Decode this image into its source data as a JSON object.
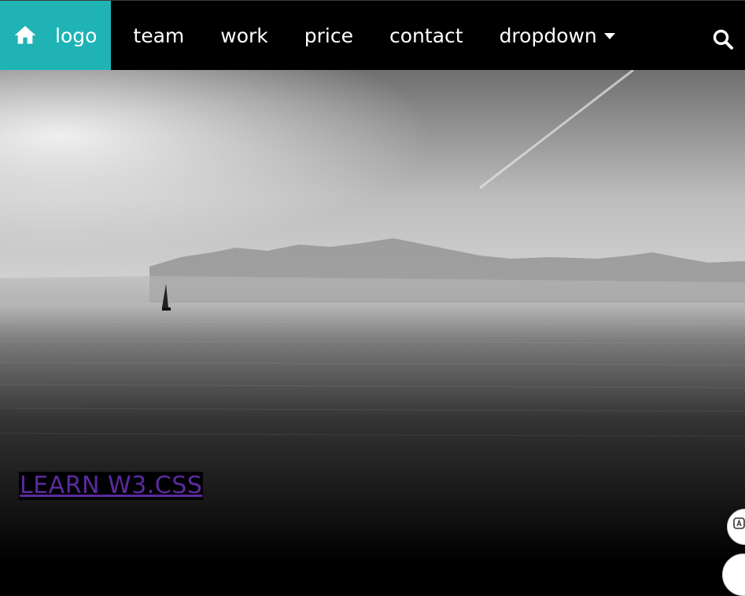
{
  "nav": {
    "logo_label": "logo",
    "items": [
      {
        "label": "team"
      },
      {
        "label": "work"
      },
      {
        "label": "price"
      },
      {
        "label": "contact"
      },
      {
        "label": "dropdown"
      }
    ],
    "icons": {
      "home": "home-icon",
      "search": "search-icon",
      "dropdown": "caret-down-icon"
    }
  },
  "hero": {
    "cta_label": "LEARN W3.CSS"
  },
  "colors": {
    "brand_teal": "#1fb3b5",
    "nav_bg": "#000000",
    "link_purple": "#5b2aa0"
  }
}
